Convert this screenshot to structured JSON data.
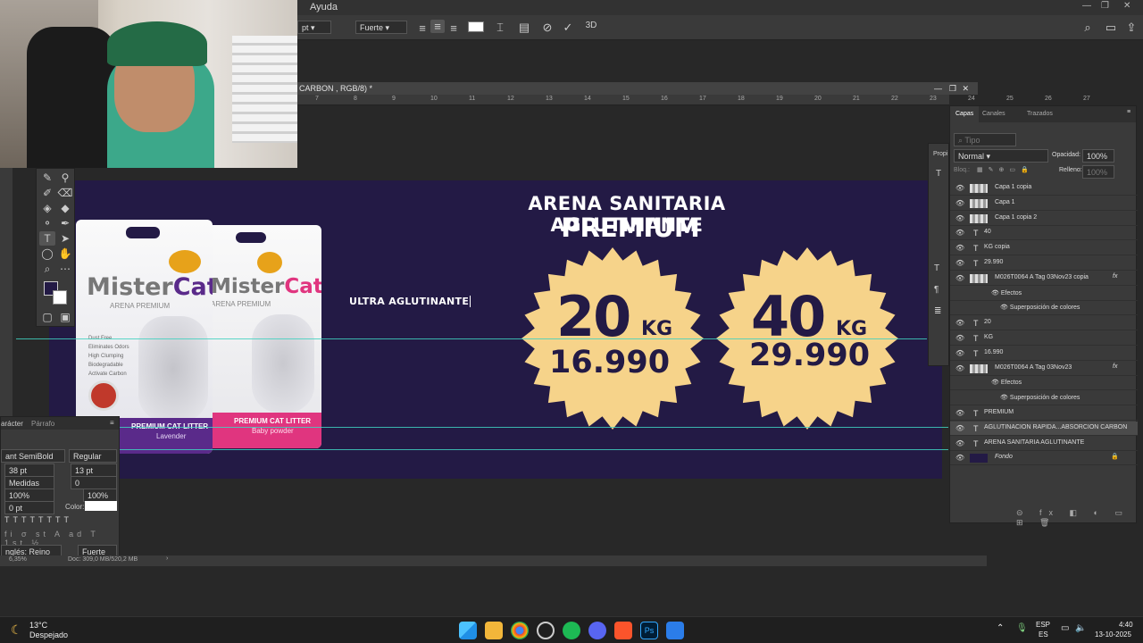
{
  "menubar": {
    "help": "Ayuda"
  },
  "options": {
    "size_value": "pt",
    "antialias": "Fuerte"
  },
  "document": {
    "tab_title": "CARBON , RGB/8) *",
    "ruler_ticks": [
      "7",
      "8",
      "9",
      "10",
      "11",
      "12",
      "13",
      "14",
      "15",
      "16",
      "17",
      "18",
      "19",
      "20",
      "21",
      "22",
      "23",
      "24",
      "25",
      "26",
      "27"
    ]
  },
  "artboard": {
    "headline_1": "ARENA SANITARIA  AGLUTINANTE",
    "headline_2": "PREMIUM",
    "text_being_edited": "ULTRA AGLUTINANTE",
    "badges": [
      {
        "weight": "20",
        "unit": "KG",
        "price": "16.990"
      },
      {
        "weight": "40",
        "unit": "KG",
        "price": "29.990"
      }
    ],
    "bags": [
      {
        "brand_a": "Mister",
        "brand_b": "Cat",
        "sub": "ARENA PREMIUM",
        "band": "PREMIUM CAT LITTER",
        "scent": "Lavender",
        "band_color": "#5a2a8a"
      },
      {
        "brand_a": "Mister",
        "brand_b": "Cat",
        "sub": "ARENA PREMIUM",
        "band": "PREMIUM CAT LITTER",
        "scent": "Baby powder",
        "band_color": "#e0357f"
      }
    ],
    "bag_features": [
      "Dust Free",
      "Eliminates Odors",
      "High Clumping",
      "Biodegradable",
      "Activate Carbon"
    ]
  },
  "character_panel": {
    "tab_character": "arácter",
    "tab_paragraph": "Párrafo",
    "font_family": "ant SemiBold",
    "font_style": "Regular",
    "font_size": "38 pt",
    "leading": "13 pt",
    "kerning": "Medidas",
    "tracking": "0",
    "vscale": "100%",
    "hscale": "100%",
    "baseline": "0 pt",
    "color_label": "Color:",
    "language": "nglés: Reino Unido",
    "antialias": "Fuerte"
  },
  "status": {
    "zoom": "6,35%",
    "doc": "Doc: 309,0 MB/520,2 MB"
  },
  "layers_panel": {
    "tabs": [
      "Capas",
      "Canales",
      "Trazados"
    ],
    "search_placeholder": "Tipo",
    "blend_mode": "Normal",
    "opacity_label": "Opacidad:",
    "opacity": "100%",
    "lock_label": "Bloq.:",
    "fill_label": "Relleno:",
    "fill": "100%",
    "layers": [
      {
        "name": "Capa 1 copia",
        "kind": "image"
      },
      {
        "name": "Capa 1",
        "kind": "image"
      },
      {
        "name": "Capa 1 copia 2",
        "kind": "image"
      },
      {
        "name": "40",
        "kind": "text"
      },
      {
        "name": "KG copia",
        "kind": "text"
      },
      {
        "name": "29.990",
        "kind": "text"
      },
      {
        "name": "M026T0064 A Tag   03Nov23 copia",
        "kind": "smart",
        "fx": true
      },
      {
        "name": "Efectos",
        "kind": "effects"
      },
      {
        "name": "Superposición de colores",
        "kind": "effect"
      },
      {
        "name": "20",
        "kind": "text"
      },
      {
        "name": "KG",
        "kind": "text"
      },
      {
        "name": "16.990",
        "kind": "text"
      },
      {
        "name": "M026T0064 A Tag   03Nov23",
        "kind": "smart",
        "fx": true
      },
      {
        "name": "Efectos",
        "kind": "effects"
      },
      {
        "name": "Superposición de colores",
        "kind": "effect"
      },
      {
        "name": "PREMIUM",
        "kind": "text"
      },
      {
        "name": "AGLUTINACION RAPIDA...ABSORCION   CARBON",
        "kind": "text-active"
      },
      {
        "name": "ARENA SANITARIA AGLUTINANTE",
        "kind": "text"
      },
      {
        "name": "Fondo",
        "kind": "fill"
      }
    ]
  },
  "props_panel": {
    "title": "Propi"
  },
  "taskbar": {
    "weather_temp": "13°C",
    "weather_desc": "Despejado",
    "lang": "ESP",
    "lang_sub": "ES",
    "time": "4:40",
    "date": "13-10-2025"
  },
  "colors": {
    "artboard": "#231a45",
    "badge": "#f6d38a",
    "badge_text": "#231a45",
    "guide": "#3fd1c0"
  }
}
